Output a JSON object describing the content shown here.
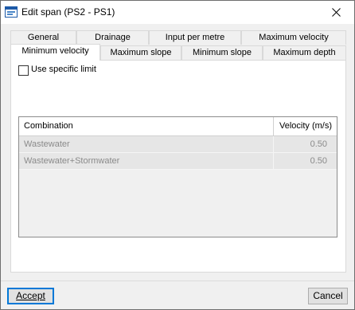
{
  "window": {
    "title": "Edit span (PS2 - PS1)"
  },
  "tabs": {
    "row_back": [
      {
        "label": "General"
      },
      {
        "label": "Drainage"
      },
      {
        "label": "Input per metre"
      },
      {
        "label": "Maximum velocity"
      }
    ],
    "row_front": [
      {
        "label": "Minimum velocity",
        "active": true
      },
      {
        "label": "Maximum slope",
        "active": false
      },
      {
        "label": "Minimum slope",
        "active": false
      },
      {
        "label": "Maximum depth",
        "active": false
      }
    ]
  },
  "panel": {
    "use_specific_limit": {
      "label": "Use specific limit",
      "checked": false
    },
    "grid": {
      "columns": [
        "Combination",
        "Velocity (m/s)"
      ],
      "rows": [
        {
          "combination": "Wastewater",
          "velocity": "0.50"
        },
        {
          "combination": "Wastewater+Stormwater",
          "velocity": "0.50"
        }
      ]
    }
  },
  "buttons": {
    "accept": "Accept",
    "cancel": "Cancel"
  }
}
